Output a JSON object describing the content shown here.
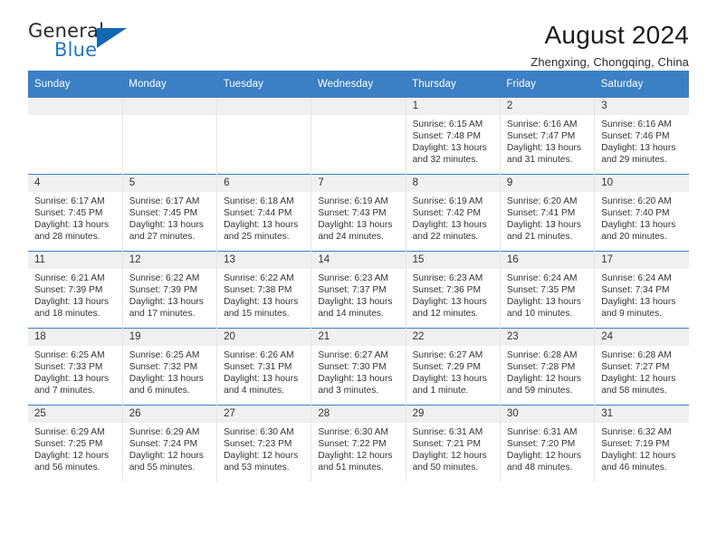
{
  "brand": {
    "name_top": "General",
    "name_bottom": "Blue",
    "accent_color": "#1268b3",
    "text_color": "#2b2b2b"
  },
  "header": {
    "title": "August 2024",
    "subtitle": "Zhengxing, Chongqing, China"
  },
  "theme": {
    "header_bg": "#3b7fc4",
    "header_text": "#ffffff",
    "daynum_bg": "#f0f0f0",
    "cell_border": "#e6e6e6",
    "row_border": "#3b7fc4"
  },
  "columns": [
    "Sunday",
    "Monday",
    "Tuesday",
    "Wednesday",
    "Thursday",
    "Friday",
    "Saturday"
  ],
  "labels": {
    "sunrise": "Sunrise:",
    "sunset": "Sunset:",
    "daylight": "Daylight:"
  },
  "weeks": [
    [
      {
        "day": "",
        "sunrise": "",
        "sunset": "",
        "daylight": ""
      },
      {
        "day": "",
        "sunrise": "",
        "sunset": "",
        "daylight": ""
      },
      {
        "day": "",
        "sunrise": "",
        "sunset": "",
        "daylight": ""
      },
      {
        "day": "",
        "sunrise": "",
        "sunset": "",
        "daylight": ""
      },
      {
        "day": "1",
        "sunrise": "Sunrise: 6:15 AM",
        "sunset": "Sunset: 7:48 PM",
        "daylight": "Daylight: 13 hours and 32 minutes."
      },
      {
        "day": "2",
        "sunrise": "Sunrise: 6:16 AM",
        "sunset": "Sunset: 7:47 PM",
        "daylight": "Daylight: 13 hours and 31 minutes."
      },
      {
        "day": "3",
        "sunrise": "Sunrise: 6:16 AM",
        "sunset": "Sunset: 7:46 PM",
        "daylight": "Daylight: 13 hours and 29 minutes."
      }
    ],
    [
      {
        "day": "4",
        "sunrise": "Sunrise: 6:17 AM",
        "sunset": "Sunset: 7:45 PM",
        "daylight": "Daylight: 13 hours and 28 minutes."
      },
      {
        "day": "5",
        "sunrise": "Sunrise: 6:17 AM",
        "sunset": "Sunset: 7:45 PM",
        "daylight": "Daylight: 13 hours and 27 minutes."
      },
      {
        "day": "6",
        "sunrise": "Sunrise: 6:18 AM",
        "sunset": "Sunset: 7:44 PM",
        "daylight": "Daylight: 13 hours and 25 minutes."
      },
      {
        "day": "7",
        "sunrise": "Sunrise: 6:19 AM",
        "sunset": "Sunset: 7:43 PM",
        "daylight": "Daylight: 13 hours and 24 minutes."
      },
      {
        "day": "8",
        "sunrise": "Sunrise: 6:19 AM",
        "sunset": "Sunset: 7:42 PM",
        "daylight": "Daylight: 13 hours and 22 minutes."
      },
      {
        "day": "9",
        "sunrise": "Sunrise: 6:20 AM",
        "sunset": "Sunset: 7:41 PM",
        "daylight": "Daylight: 13 hours and 21 minutes."
      },
      {
        "day": "10",
        "sunrise": "Sunrise: 6:20 AM",
        "sunset": "Sunset: 7:40 PM",
        "daylight": "Daylight: 13 hours and 20 minutes."
      }
    ],
    [
      {
        "day": "11",
        "sunrise": "Sunrise: 6:21 AM",
        "sunset": "Sunset: 7:39 PM",
        "daylight": "Daylight: 13 hours and 18 minutes."
      },
      {
        "day": "12",
        "sunrise": "Sunrise: 6:22 AM",
        "sunset": "Sunset: 7:39 PM",
        "daylight": "Daylight: 13 hours and 17 minutes."
      },
      {
        "day": "13",
        "sunrise": "Sunrise: 6:22 AM",
        "sunset": "Sunset: 7:38 PM",
        "daylight": "Daylight: 13 hours and 15 minutes."
      },
      {
        "day": "14",
        "sunrise": "Sunrise: 6:23 AM",
        "sunset": "Sunset: 7:37 PM",
        "daylight": "Daylight: 13 hours and 14 minutes."
      },
      {
        "day": "15",
        "sunrise": "Sunrise: 6:23 AM",
        "sunset": "Sunset: 7:36 PM",
        "daylight": "Daylight: 13 hours and 12 minutes."
      },
      {
        "day": "16",
        "sunrise": "Sunrise: 6:24 AM",
        "sunset": "Sunset: 7:35 PM",
        "daylight": "Daylight: 13 hours and 10 minutes."
      },
      {
        "day": "17",
        "sunrise": "Sunrise: 6:24 AM",
        "sunset": "Sunset: 7:34 PM",
        "daylight": "Daylight: 13 hours and 9 minutes."
      }
    ],
    [
      {
        "day": "18",
        "sunrise": "Sunrise: 6:25 AM",
        "sunset": "Sunset: 7:33 PM",
        "daylight": "Daylight: 13 hours and 7 minutes."
      },
      {
        "day": "19",
        "sunrise": "Sunrise: 6:25 AM",
        "sunset": "Sunset: 7:32 PM",
        "daylight": "Daylight: 13 hours and 6 minutes."
      },
      {
        "day": "20",
        "sunrise": "Sunrise: 6:26 AM",
        "sunset": "Sunset: 7:31 PM",
        "daylight": "Daylight: 13 hours and 4 minutes."
      },
      {
        "day": "21",
        "sunrise": "Sunrise: 6:27 AM",
        "sunset": "Sunset: 7:30 PM",
        "daylight": "Daylight: 13 hours and 3 minutes."
      },
      {
        "day": "22",
        "sunrise": "Sunrise: 6:27 AM",
        "sunset": "Sunset: 7:29 PM",
        "daylight": "Daylight: 13 hours and 1 minute."
      },
      {
        "day": "23",
        "sunrise": "Sunrise: 6:28 AM",
        "sunset": "Sunset: 7:28 PM",
        "daylight": "Daylight: 12 hours and 59 minutes."
      },
      {
        "day": "24",
        "sunrise": "Sunrise: 6:28 AM",
        "sunset": "Sunset: 7:27 PM",
        "daylight": "Daylight: 12 hours and 58 minutes."
      }
    ],
    [
      {
        "day": "25",
        "sunrise": "Sunrise: 6:29 AM",
        "sunset": "Sunset: 7:25 PM",
        "daylight": "Daylight: 12 hours and 56 minutes."
      },
      {
        "day": "26",
        "sunrise": "Sunrise: 6:29 AM",
        "sunset": "Sunset: 7:24 PM",
        "daylight": "Daylight: 12 hours and 55 minutes."
      },
      {
        "day": "27",
        "sunrise": "Sunrise: 6:30 AM",
        "sunset": "Sunset: 7:23 PM",
        "daylight": "Daylight: 12 hours and 53 minutes."
      },
      {
        "day": "28",
        "sunrise": "Sunrise: 6:30 AM",
        "sunset": "Sunset: 7:22 PM",
        "daylight": "Daylight: 12 hours and 51 minutes."
      },
      {
        "day": "29",
        "sunrise": "Sunrise: 6:31 AM",
        "sunset": "Sunset: 7:21 PM",
        "daylight": "Daylight: 12 hours and 50 minutes."
      },
      {
        "day": "30",
        "sunrise": "Sunrise: 6:31 AM",
        "sunset": "Sunset: 7:20 PM",
        "daylight": "Daylight: 12 hours and 48 minutes."
      },
      {
        "day": "31",
        "sunrise": "Sunrise: 6:32 AM",
        "sunset": "Sunset: 7:19 PM",
        "daylight": "Daylight: 12 hours and 46 minutes."
      }
    ]
  ]
}
